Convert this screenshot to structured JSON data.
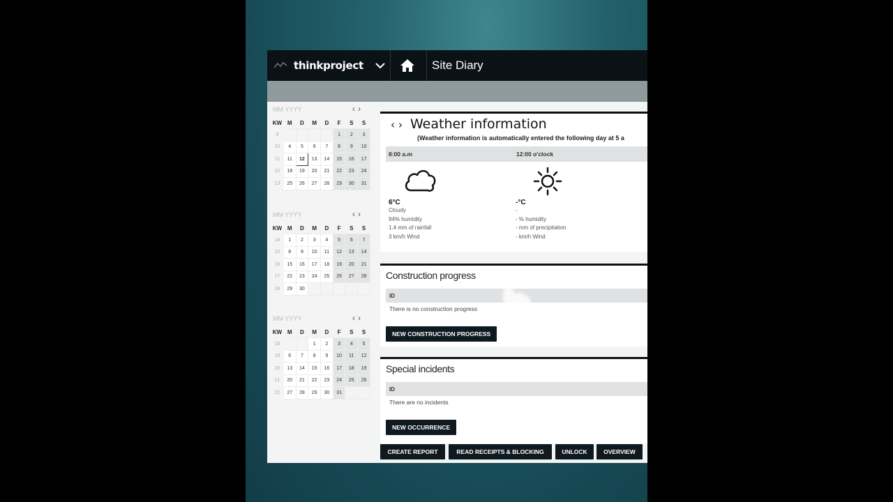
{
  "header": {
    "brand": "thinkproject",
    "breadcrumb": "Site Diary"
  },
  "calendars": [
    {
      "placeholder": "MM YYYY",
      "days": [
        "KW",
        "M",
        "D",
        "M",
        "D",
        "F",
        "S",
        "S"
      ],
      "rows": [
        [
          "9",
          "",
          "",
          "",
          "",
          "1",
          "2",
          "3"
        ],
        [
          "10",
          "4",
          "5",
          "6",
          "7",
          "8",
          "9",
          "10"
        ],
        [
          "11",
          "11",
          "12",
          "13",
          "14",
          "15",
          "16",
          "17"
        ],
        [
          "12",
          "18",
          "19",
          "20",
          "21",
          "22",
          "23",
          "24"
        ],
        [
          "13",
          "25",
          "26",
          "27",
          "28",
          "29",
          "30",
          "31"
        ]
      ],
      "selected": "12"
    },
    {
      "placeholder": "MM YYYY",
      "days": [
        "KW",
        "M",
        "D",
        "M",
        "D",
        "F",
        "S",
        "S"
      ],
      "rows": [
        [
          "14",
          "1",
          "2",
          "3",
          "4",
          "5",
          "6",
          "7"
        ],
        [
          "15",
          "8",
          "9",
          "10",
          "11",
          "12",
          "13",
          "14"
        ],
        [
          "16",
          "15",
          "16",
          "17",
          "18",
          "19",
          "20",
          "21"
        ],
        [
          "17",
          "22",
          "23",
          "24",
          "25",
          "26",
          "27",
          "28"
        ],
        [
          "18",
          "29",
          "30",
          "",
          "",
          "",
          "",
          ""
        ]
      ],
      "selected": ""
    },
    {
      "placeholder": "MM YYYY",
      "days": [
        "KW",
        "M",
        "D",
        "M",
        "D",
        "F",
        "S",
        "S"
      ],
      "rows": [
        [
          "18",
          "",
          "",
          "1",
          "2",
          "3",
          "4",
          "5"
        ],
        [
          "19",
          "6",
          "7",
          "8",
          "9",
          "10",
          "11",
          "12"
        ],
        [
          "20",
          "13",
          "14",
          "15",
          "16",
          "17",
          "18",
          "19"
        ],
        [
          "21",
          "20",
          "21",
          "22",
          "23",
          "24",
          "25",
          "26"
        ],
        [
          "22",
          "27",
          "28",
          "29",
          "30",
          "31",
          "",
          ""
        ]
      ],
      "selected": ""
    }
  ],
  "weather": {
    "title": "Weather information",
    "note": "(Weather information is automatically entered the following day at 5 a",
    "columns": [
      {
        "time": "8:00 a.m",
        "icon": "cloud-icon",
        "temp": "6°C",
        "lines": [
          "Cloudy",
          "94% humidity",
          "1.4 mm of rainfall",
          "3 km/h Wind"
        ]
      },
      {
        "time": "12:00 o'clock",
        "icon": "sun-icon",
        "temp": "-°C",
        "lines": [
          "-",
          "- % humidity",
          "- mm of precipitation",
          "- km/h Wind"
        ]
      }
    ]
  },
  "construction": {
    "title": "Construction progress",
    "col_header": "ID",
    "empty": "There is no construction progress",
    "button": "NEW CONSTRUCTION PROGRESS"
  },
  "incidents": {
    "title": "Special incidents",
    "col_header": "ID",
    "empty": "There are no incidents",
    "button": "NEW OCCURRENCE"
  },
  "footer": {
    "create_report": "CREATE REPORT",
    "read_receipts": "READ RECEIPTS & BLOCKING",
    "unlock": "UNLOCK",
    "overview": "OVERVIEW"
  }
}
